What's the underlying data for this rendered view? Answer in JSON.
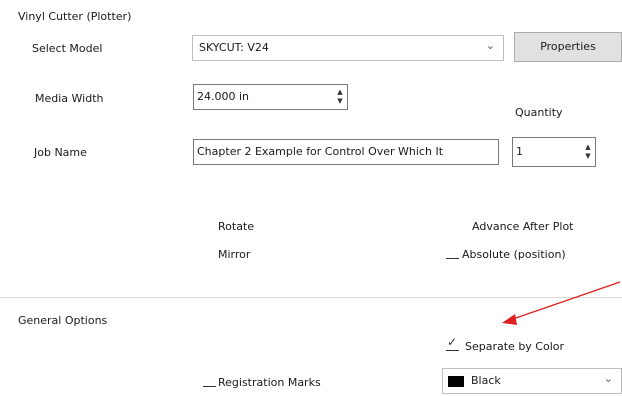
{
  "section_plotter": {
    "title": "Vinyl Cutter (Plotter)"
  },
  "model": {
    "label": "Select Model",
    "value": "SKYCUT: V24"
  },
  "properties_button": {
    "label": "Properties"
  },
  "media_width": {
    "label": "Media Width",
    "value": "24.000 in"
  },
  "quantity": {
    "label": "Quantity",
    "value": "1"
  },
  "job_name": {
    "label": "Job Name",
    "value": "Chapter 2 Example for Control Over Which It"
  },
  "options": {
    "rotate": "Rotate",
    "mirror": "Mirror",
    "advance_after_plot": "Advance After Plot",
    "absolute_position": "Absolute (position)"
  },
  "general_options": {
    "title": "General Options",
    "separate_by_color": "Separate by Color",
    "registration_marks": "Registration Marks",
    "color_value": "Black",
    "color_swatch": "#000000"
  },
  "annotation": {
    "arrow_color": "#e02020"
  }
}
